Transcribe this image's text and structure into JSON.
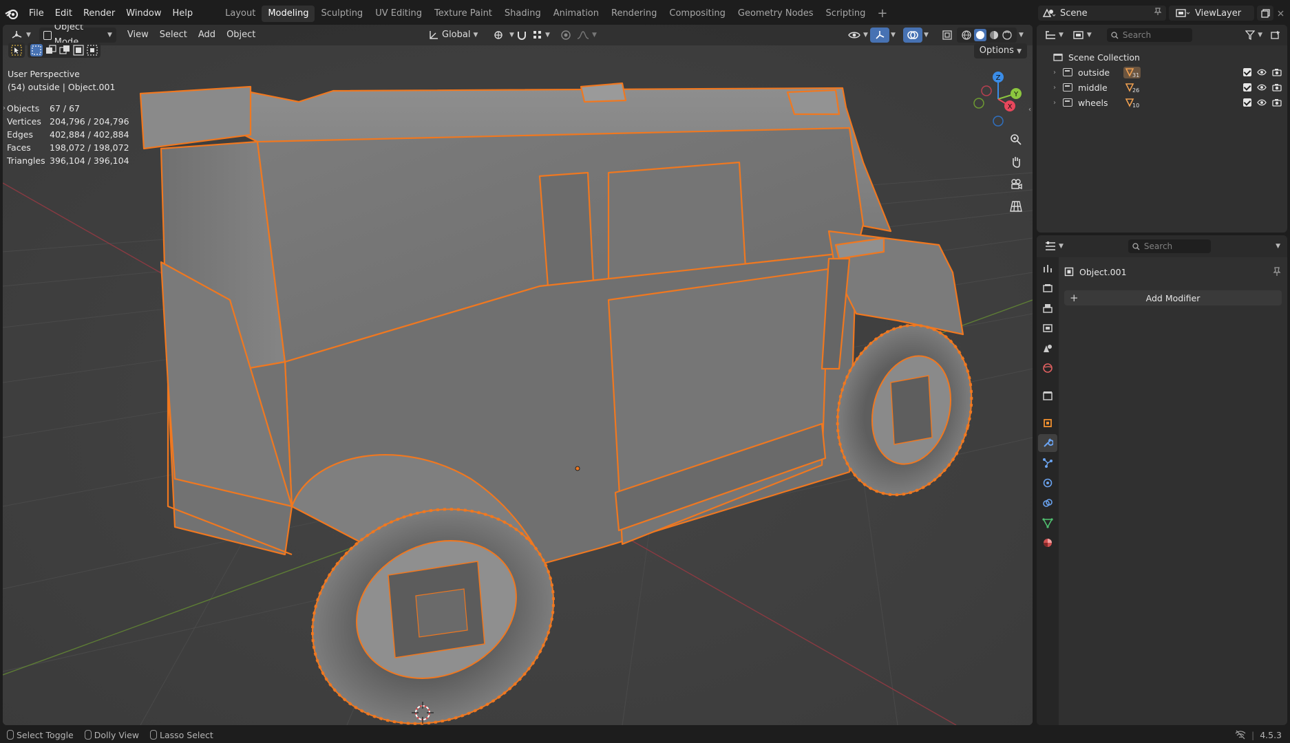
{
  "menu": [
    "File",
    "Edit",
    "Render",
    "Window",
    "Help"
  ],
  "workspaces": [
    {
      "label": "Layout",
      "active": false
    },
    {
      "label": "Modeling",
      "active": true
    },
    {
      "label": "Sculpting",
      "active": false
    },
    {
      "label": "UV Editing",
      "active": false
    },
    {
      "label": "Texture Paint",
      "active": false
    },
    {
      "label": "Shading",
      "active": false
    },
    {
      "label": "Animation",
      "active": false
    },
    {
      "label": "Rendering",
      "active": false
    },
    {
      "label": "Compositing",
      "active": false
    },
    {
      "label": "Geometry Nodes",
      "active": false
    },
    {
      "label": "Scripting",
      "active": false
    }
  ],
  "workspace_add": "+",
  "scene": {
    "name": "Scene"
  },
  "view_layer": {
    "name": "ViewLayer"
  },
  "viewport_header": {
    "mode": "Object Mode",
    "menus": [
      "View",
      "Select",
      "Add",
      "Object"
    ],
    "transform_orientation": "Global"
  },
  "viewport": {
    "perspective_label": "User Perspective",
    "context_label": "(54) outside | Object.001",
    "options_label": "Options",
    "stats": [
      {
        "label": "Objects",
        "value": "67 / 67"
      },
      {
        "label": "Vertices",
        "value": "204,796 / 204,796"
      },
      {
        "label": "Edges",
        "value": "402,884 / 402,884"
      },
      {
        "label": "Faces",
        "value": "198,072 / 198,072"
      },
      {
        "label": "Triangles",
        "value": "396,104 / 396,104"
      }
    ],
    "gizmo_axes": {
      "z": "Z",
      "y": "Y",
      "x": "X"
    }
  },
  "outliner": {
    "search_placeholder": "Search",
    "root": "Scene Collection",
    "collections": [
      {
        "name": "outside",
        "count": "31"
      },
      {
        "name": "middle",
        "count": "26"
      },
      {
        "name": "wheels",
        "count": "10"
      }
    ]
  },
  "properties": {
    "search_placeholder": "Search",
    "object_name": "Object.001",
    "add_modifier_label": "Add Modifier",
    "add_modifier_icon": "+"
  },
  "statusbar": {
    "items": [
      "Select Toggle",
      "Dolly View",
      "Lasso Select"
    ],
    "version": "4.5.3"
  },
  "colors": {
    "accent_orange": "#f07820",
    "active_blue": "#4772b3",
    "axis_x": "#e8475c",
    "axis_y": "#8cc63f",
    "axis_z": "#3b8de8"
  }
}
